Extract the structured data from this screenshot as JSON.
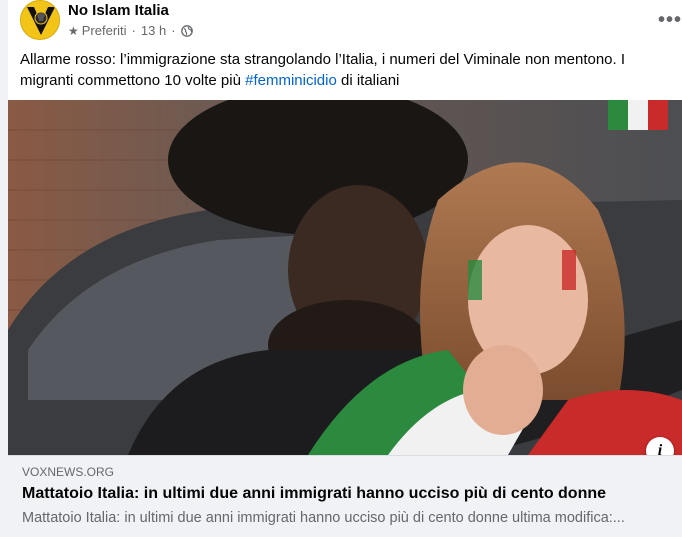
{
  "post": {
    "page_name": "No Islam Italia",
    "meta": {
      "favorites_label": "Preferiti",
      "time": "13 h",
      "audience_icon": "globe-icon",
      "favorites_icon": "star-icon"
    },
    "more_icon": "more-options-icon",
    "text_before_hashtag": "Allarme rosso: l’immigrazione sta strangolando l’Italia, i numeri del Viminale non mentono. I migranti commettono 10 volte più ",
    "hashtag": "#femminicidio",
    "text_after_hashtag": " di italiani"
  },
  "link_preview": {
    "domain": "VOXNEWS.ORG",
    "headline": "Mattatoio Italia: in ultimi due anni immigrati hanno ucciso più di cento donne",
    "description": "Mattatoio Italia: in ultimi due anni immigrati hanno ucciso più di cento donne ultima modifica:...",
    "info_icon": "info-icon",
    "info_label": "i"
  },
  "colors": {
    "hashtag": "#0064d1",
    "secondary_text": "#65676b",
    "preview_background": "#f0f2f5",
    "avatar_background": "#f2c418"
  }
}
